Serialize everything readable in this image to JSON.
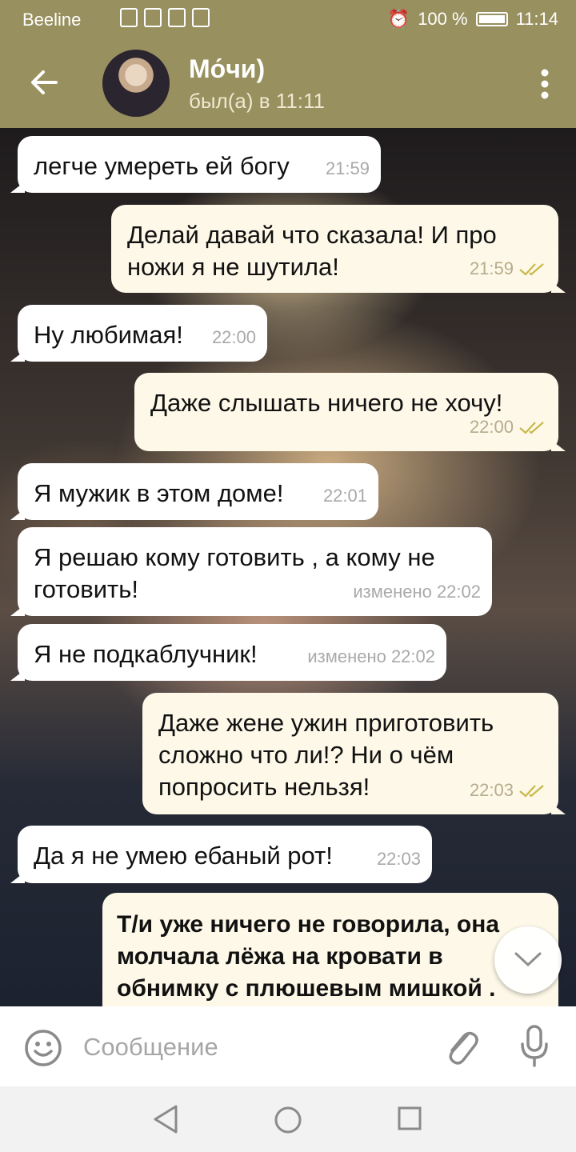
{
  "status_bar": {
    "carrier": "Beeline",
    "battery": "100 %",
    "time": "11:14"
  },
  "header": {
    "contact_name": "Мо́чи)",
    "contact_status": "был(а) в 11:11"
  },
  "messages": [
    {
      "text": "легче умереть ей богу",
      "meta": "21:59",
      "direction": "in"
    },
    {
      "text": "Делай давай что сказала! И про ножи я не шутила!",
      "meta": "21:59",
      "direction": "out",
      "read": true
    },
    {
      "text": "Ну любимая!",
      "meta": "22:00",
      "direction": "in"
    },
    {
      "text": "Даже слышать ничего не хочу!",
      "meta": "22:00",
      "direction": "out",
      "read": true
    },
    {
      "text": "Я мужик в этом доме!",
      "meta": "22:01",
      "direction": "in"
    },
    {
      "text": "Я решаю кому готовить , а кому не готовить!",
      "meta": "изменено 22:02",
      "direction": "in"
    },
    {
      "text": "Я не подкаблучник!",
      "meta": "изменено 22:02",
      "direction": "in"
    },
    {
      "text": "Даже жене ужин приготовить сложно что ли!? Ни о чём попросить нельзя!",
      "meta": "22:03",
      "direction": "out",
      "read": true
    },
    {
      "text": "Да я не умею ебаный рот!",
      "meta": "22:03",
      "direction": "in"
    },
    {
      "text": "Т/и уже ничего не говорила, она молчала лёжа на кровати в обнимку с плюшевым мишкой .",
      "direction": "out"
    }
  ],
  "composer": {
    "placeholder": "Сообщение"
  },
  "colors": {
    "header": "#98905e",
    "incoming": "#ffffff",
    "outgoing": "#fdf8e8",
    "checks": "#c9b84a"
  },
  "icons": [
    "back-arrow-icon",
    "more-vert-icon",
    "double-check-icon",
    "chevron-down-icon",
    "emoji-icon",
    "attach-icon",
    "mic-icon",
    "nav-back-icon",
    "nav-home-icon",
    "nav-recent-icon"
  ]
}
